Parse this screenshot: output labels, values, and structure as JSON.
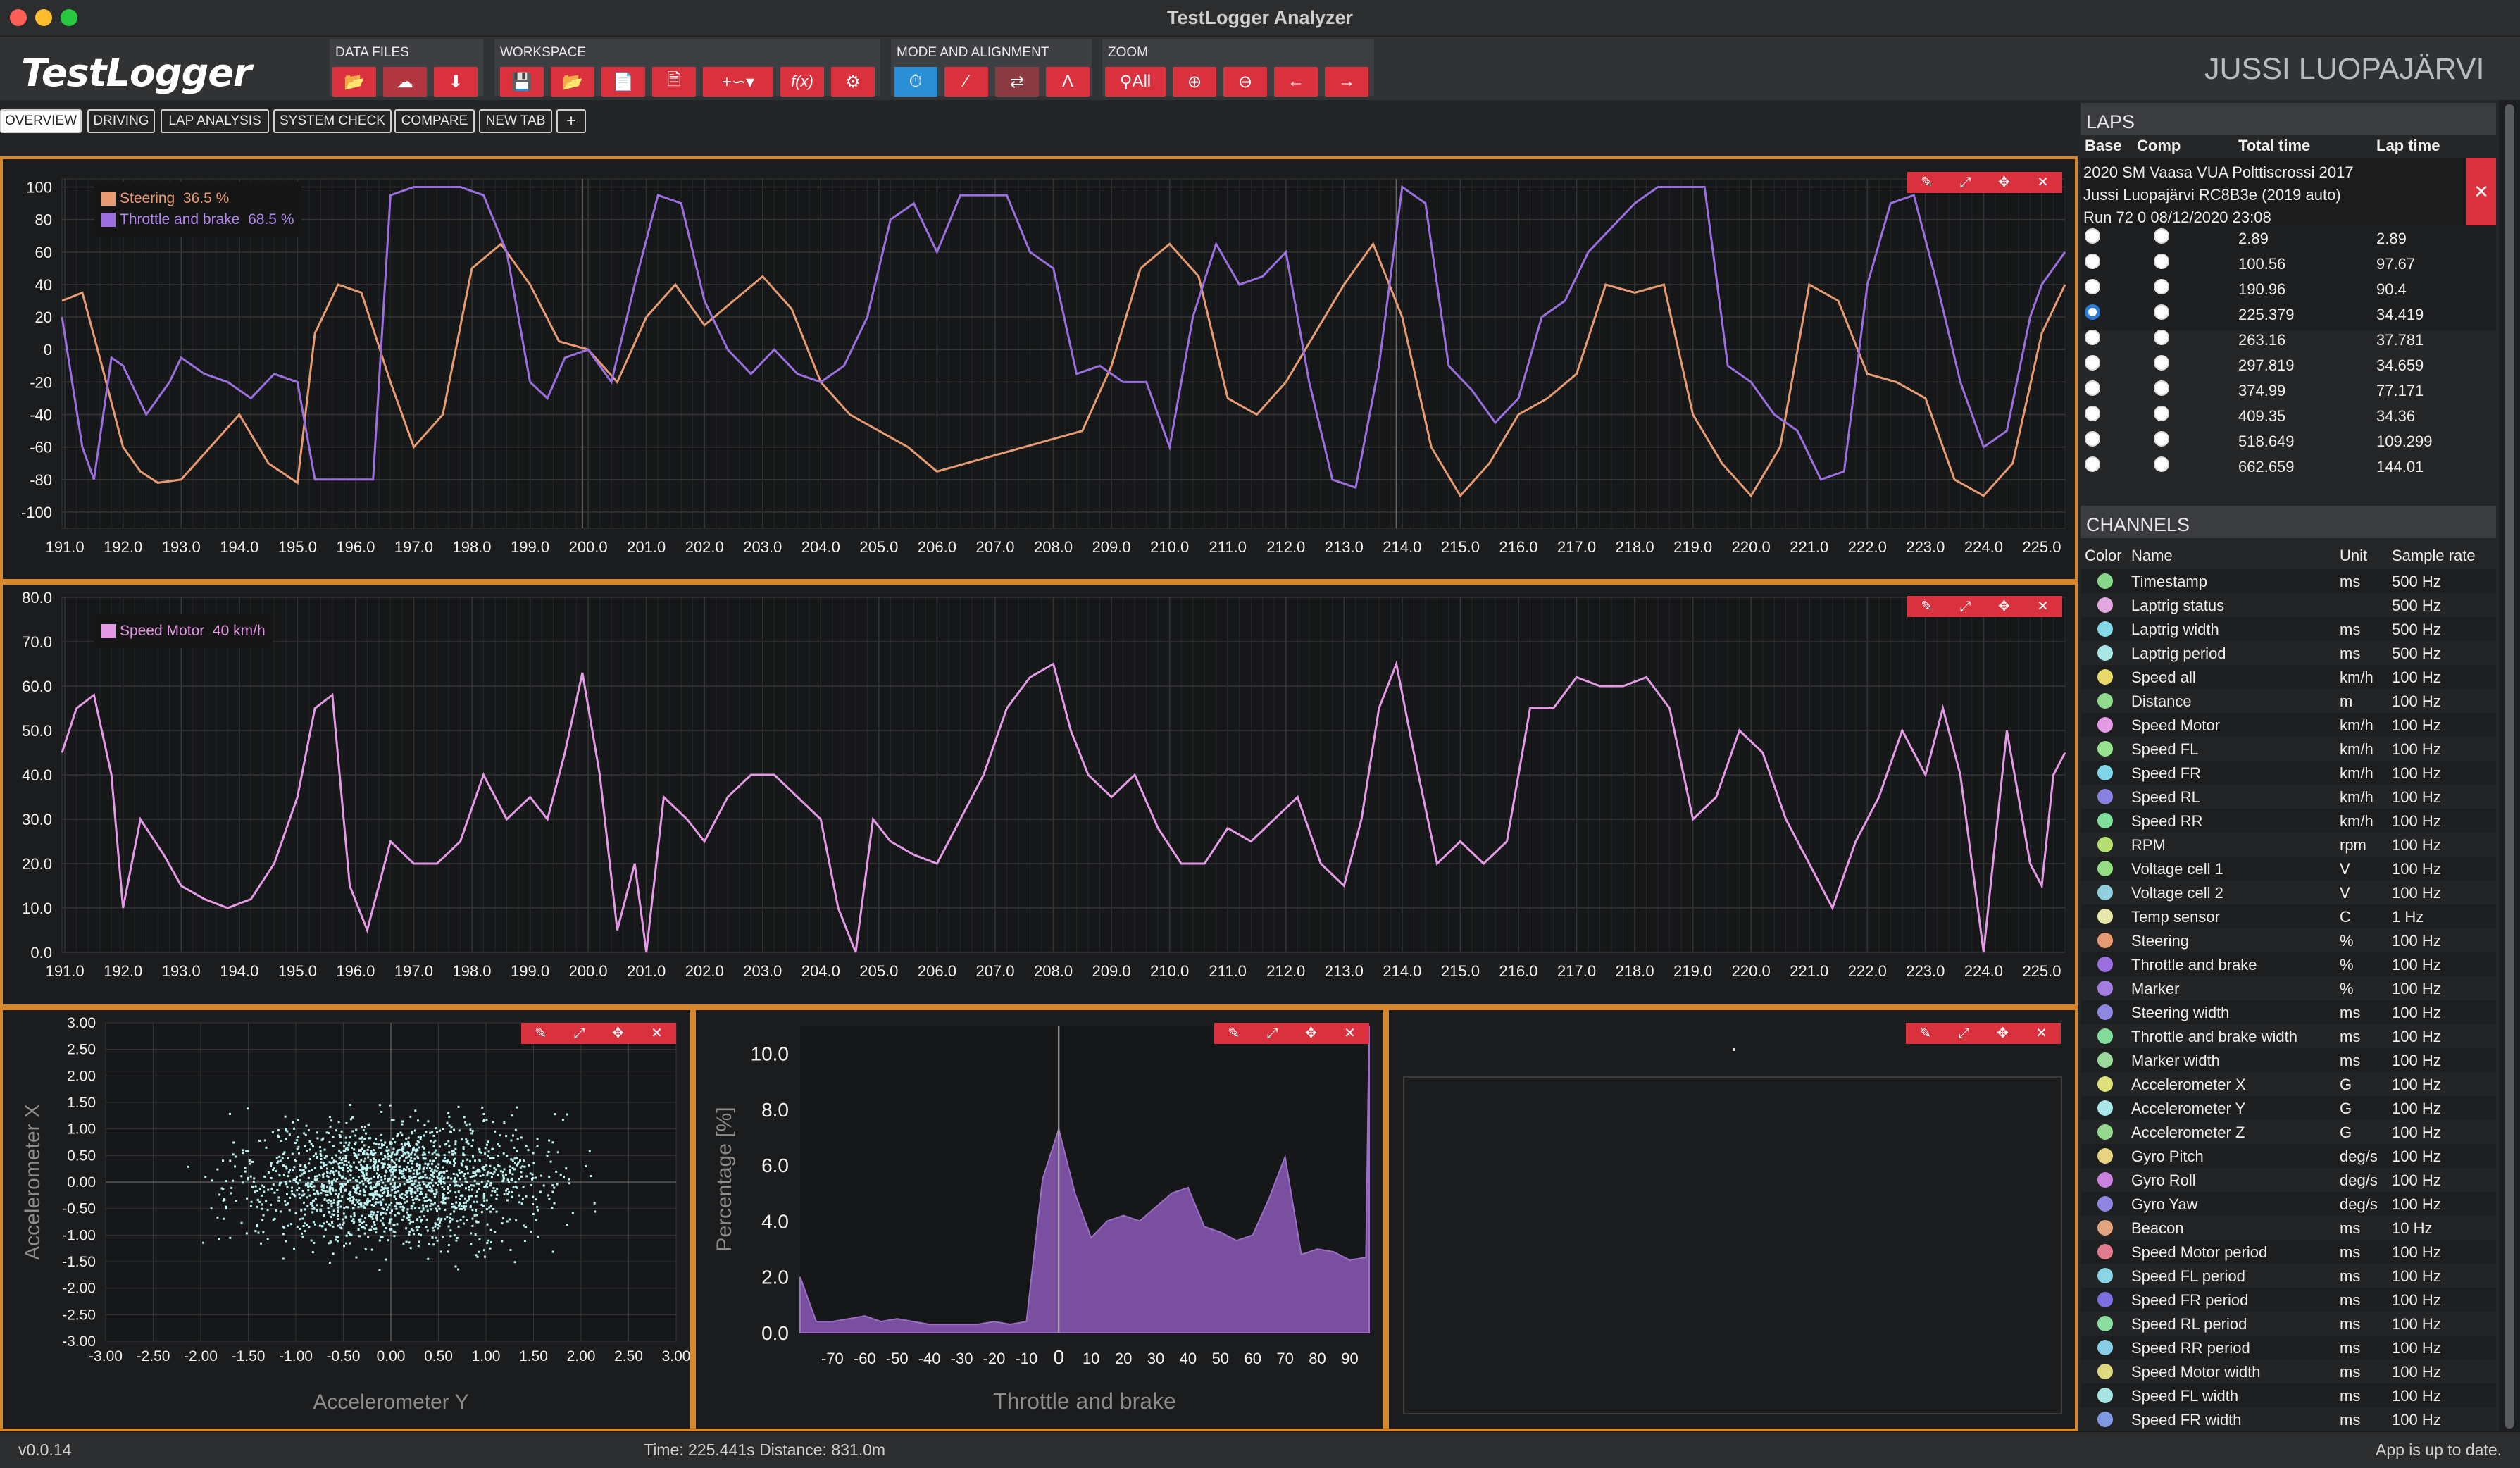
{
  "window": {
    "title": "TestLogger Analyzer"
  },
  "logo": "TestLogger",
  "toolbar": {
    "groups": [
      {
        "label": "DATA FILES"
      },
      {
        "label": "WORKSPACE"
      },
      {
        "label": "MODE AND ALIGNMENT"
      },
      {
        "label": "ZOOM"
      }
    ],
    "zoom_all": "All",
    "fx": "f(x)"
  },
  "user": "JUSSI LUOPAJÄRVI",
  "tabs": [
    "OVERVIEW",
    "DRIVING",
    "LAP ANALYSIS",
    "SYSTEM CHECK",
    "COMPARE",
    "NEW TAB",
    "+"
  ],
  "laps": {
    "title": "LAPS",
    "columns": [
      "Base",
      "Comp",
      "Total time",
      "Lap time"
    ],
    "event": "2020 SM Vaasa VUA Polttiscrossi 2017",
    "driver": "Jussi Luopajärvi RC8B3e (2019 auto)",
    "run": "Run 72 0 08/12/2020 23:08",
    "close": "✕",
    "rows": [
      {
        "total": "2.89",
        "lap": "2.89"
      },
      {
        "total": "100.56",
        "lap": "97.67"
      },
      {
        "total": "190.96",
        "lap": "90.4"
      },
      {
        "total": "225.379",
        "lap": "34.419"
      },
      {
        "total": "263.16",
        "lap": "37.781"
      },
      {
        "total": "297.819",
        "lap": "34.659"
      },
      {
        "total": "374.99",
        "lap": "77.171"
      },
      {
        "total": "409.35",
        "lap": "34.36"
      },
      {
        "total": "518.649",
        "lap": "109.299"
      },
      {
        "total": "662.659",
        "lap": "144.01"
      }
    ],
    "selected_base": 3
  },
  "channels": {
    "title": "CHANNELS",
    "columns": [
      "Color",
      "Name",
      "Unit",
      "Sample rate"
    ],
    "rows": [
      {
        "name": "Timestamp",
        "unit": "ms",
        "rate": "500 Hz",
        "color": "#88d88a"
      },
      {
        "name": "Laptrig status",
        "unit": "",
        "rate": "500 Hz",
        "color": "#e2a6e0"
      },
      {
        "name": "Laptrig width",
        "unit": "ms",
        "rate": "500 Hz",
        "color": "#84d9e8"
      },
      {
        "name": "Laptrig period",
        "unit": "ms",
        "rate": "500 Hz",
        "color": "#a9e6e6"
      },
      {
        "name": "Speed all",
        "unit": "km/h",
        "rate": "100 Hz",
        "color": "#e9d96b"
      },
      {
        "name": "Distance",
        "unit": "m",
        "rate": "100 Hz",
        "color": "#8fdc8f"
      },
      {
        "name": "Speed Motor",
        "unit": "km/h",
        "rate": "100 Hz",
        "color": "#e59ae6"
      },
      {
        "name": "Speed FL",
        "unit": "km/h",
        "rate": "100 Hz",
        "color": "#97e28f"
      },
      {
        "name": "Speed FR",
        "unit": "km/h",
        "rate": "100 Hz",
        "color": "#7fd6ea"
      },
      {
        "name": "Speed RL",
        "unit": "km/h",
        "rate": "100 Hz",
        "color": "#8a82e0"
      },
      {
        "name": "Speed RR",
        "unit": "km/h",
        "rate": "100 Hz",
        "color": "#7fdf9a"
      },
      {
        "name": "RPM",
        "unit": "rpm",
        "rate": "100 Hz",
        "color": "#b6df73"
      },
      {
        "name": "Voltage cell 1",
        "unit": "V",
        "rate": "100 Hz",
        "color": "#93dd82"
      },
      {
        "name": "Voltage cell 2",
        "unit": "V",
        "rate": "100 Hz",
        "color": "#8fcfe0"
      },
      {
        "name": "Temp sensor",
        "unit": "C",
        "rate": "1 Hz",
        "color": "#e6e6a8"
      },
      {
        "name": "Steering",
        "unit": "%",
        "rate": "100 Hz",
        "color": "#e79b72"
      },
      {
        "name": "Throttle and brake",
        "unit": "%",
        "rate": "100 Hz",
        "color": "#9b6fe0"
      },
      {
        "name": "Marker",
        "unit": "%",
        "rate": "100 Hz",
        "color": "#a37ee0"
      },
      {
        "name": "Steering width",
        "unit": "ms",
        "rate": "100 Hz",
        "color": "#8e88e2"
      },
      {
        "name": "Throttle and brake width",
        "unit": "ms",
        "rate": "100 Hz",
        "color": "#84dc9a"
      },
      {
        "name": "Marker width",
        "unit": "ms",
        "rate": "100 Hz",
        "color": "#9ad99a"
      },
      {
        "name": "Accelerometer X",
        "unit": "G",
        "rate": "100 Hz",
        "color": "#dfe27a"
      },
      {
        "name": "Accelerometer Y",
        "unit": "G",
        "rate": "100 Hz",
        "color": "#a8e8e8"
      },
      {
        "name": "Accelerometer Z",
        "unit": "G",
        "rate": "100 Hz",
        "color": "#94d98e"
      },
      {
        "name": "Gyro Pitch",
        "unit": "deg/s",
        "rate": "100 Hz",
        "color": "#e8d480"
      },
      {
        "name": "Gyro Roll",
        "unit": "deg/s",
        "rate": "100 Hz",
        "color": "#c982e0"
      },
      {
        "name": "Gyro Yaw",
        "unit": "deg/s",
        "rate": "100 Hz",
        "color": "#8f84e2"
      },
      {
        "name": "Beacon",
        "unit": "ms",
        "rate": "10 Hz",
        "color": "#e2a47e"
      },
      {
        "name": "Speed Motor period",
        "unit": "ms",
        "rate": "100 Hz",
        "color": "#e07c8e"
      },
      {
        "name": "Speed FL period",
        "unit": "ms",
        "rate": "100 Hz",
        "color": "#8ad6e6"
      },
      {
        "name": "Speed FR period",
        "unit": "ms",
        "rate": "100 Hz",
        "color": "#7e6fe0"
      },
      {
        "name": "Speed RL period",
        "unit": "ms",
        "rate": "100 Hz",
        "color": "#88dfa0"
      },
      {
        "name": "Speed RR period",
        "unit": "ms",
        "rate": "100 Hz",
        "color": "#86cfe6"
      },
      {
        "name": "Speed Motor width",
        "unit": "ms",
        "rate": "100 Hz",
        "color": "#dcd980"
      },
      {
        "name": "Speed FL width",
        "unit": "ms",
        "rate": "100 Hz",
        "color": "#a7e3e3"
      },
      {
        "name": "Speed FR width",
        "unit": "ms",
        "rate": "100 Hz",
        "color": "#7f9ae2"
      }
    ]
  },
  "status": {
    "version": "v0.0.14",
    "readout": "Time: 225.441s Distance: 831.0m",
    "update": "App is up to date."
  },
  "chart_data": [
    {
      "type": "line",
      "series": [
        {
          "name": "Steering",
          "value_label": "36.5 %",
          "color": "#e79b72"
        },
        {
          "name": "Throttle and brake",
          "value_label": "68.5 %",
          "color": "#9b6fe0"
        }
      ],
      "x_ticks": [
        "191.0",
        "192.0",
        "193.0",
        "194.0",
        "195.0",
        "196.0",
        "197.0",
        "198.0",
        "199.0",
        "200.0",
        "201.0",
        "202.0",
        "203.0",
        "204.0",
        "205.0",
        "206.0",
        "207.0",
        "208.0",
        "209.0",
        "210.0",
        "211.0",
        "212.0",
        "213.0",
        "214.0",
        "215.0",
        "216.0",
        "217.0",
        "218.0",
        "219.0",
        "220.0",
        "221.0",
        "222.0",
        "223.0",
        "224.0",
        "225.0"
      ],
      "y_ticks": [
        "100",
        "80",
        "60",
        "40",
        "20",
        "0",
        "-20",
        "-40",
        "-60",
        "-80",
        "-100"
      ],
      "xlim": [
        190.95,
        225.4
      ],
      "ylim": [
        -110,
        105
      ],
      "steering_x": [
        190.95,
        191.3,
        191.6,
        192.0,
        192.3,
        192.6,
        193.0,
        193.5,
        194.0,
        194.5,
        195.0,
        195.3,
        195.7,
        196.1,
        196.6,
        197.0,
        197.5,
        198.0,
        198.5,
        199.0,
        199.5,
        200.0,
        200.5,
        201.0,
        201.5,
        202.0,
        202.5,
        203.0,
        203.5,
        204.0,
        204.5,
        205.0,
        205.5,
        206.0,
        206.5,
        207.0,
        207.5,
        208.0,
        208.5,
        209.0,
        209.5,
        210.0,
        210.5,
        211.0,
        211.5,
        212.0,
        212.5,
        213.0,
        213.5,
        214.0,
        214.5,
        215.0,
        215.5,
        216.0,
        216.5,
        217.0,
        217.5,
        218.0,
        218.5,
        219.0,
        219.5,
        220.0,
        220.5,
        221.0,
        221.5,
        222.0,
        222.5,
        223.0,
        223.5,
        224.0,
        224.5,
        225.0,
        225.4
      ],
      "steering_y": [
        30,
        35,
        -5,
        -60,
        -75,
        -82,
        -80,
        -60,
        -40,
        -70,
        -82,
        10,
        40,
        35,
        -20,
        -60,
        -40,
        50,
        65,
        40,
        5,
        0,
        -20,
        20,
        40,
        15,
        30,
        45,
        25,
        -20,
        -40,
        -50,
        -60,
        -75,
        -70,
        -65,
        -60,
        -55,
        -50,
        -10,
        50,
        65,
        45,
        -30,
        -40,
        -20,
        10,
        40,
        65,
        20,
        -60,
        -90,
        -70,
        -40,
        -30,
        -15,
        40,
        35,
        40,
        -40,
        -70,
        -90,
        -60,
        40,
        30,
        -15,
        -20,
        -30,
        -80,
        -90,
        -70,
        10,
        40
      ],
      "throttle_x": [
        190.95,
        191.3,
        191.5,
        191.8,
        192.0,
        192.4,
        192.8,
        193.0,
        193.4,
        193.8,
        194.2,
        194.6,
        195.0,
        195.3,
        195.6,
        196.0,
        196.3,
        196.6,
        197.0,
        197.4,
        197.8,
        198.2,
        198.6,
        199.0,
        199.3,
        199.6,
        200.0,
        200.4,
        200.8,
        201.2,
        201.6,
        202.0,
        202.4,
        202.8,
        203.2,
        203.6,
        204.0,
        204.4,
        204.8,
        205.2,
        205.6,
        206.0,
        206.4,
        206.8,
        207.2,
        207.6,
        208.0,
        208.4,
        208.8,
        209.2,
        209.6,
        210.0,
        210.4,
        210.8,
        211.2,
        211.6,
        212.0,
        212.4,
        212.8,
        213.2,
        213.6,
        214.0,
        214.4,
        214.8,
        215.2,
        215.6,
        216.0,
        216.4,
        216.8,
        217.2,
        217.6,
        218.0,
        218.4,
        218.8,
        219.2,
        219.6,
        220.0,
        220.4,
        220.8,
        221.2,
        221.6,
        222.0,
        222.4,
        222.8,
        223.2,
        223.6,
        224.0,
        224.4,
        224.8,
        225.0,
        225.4
      ],
      "throttle_y": [
        20,
        -60,
        -80,
        -5,
        -10,
        -40,
        -20,
        -5,
        -15,
        -20,
        -30,
        -15,
        -20,
        -80,
        -80,
        -80,
        -80,
        95,
        100,
        100,
        100,
        95,
        60,
        -20,
        -30,
        -5,
        0,
        -20,
        40,
        95,
        90,
        30,
        0,
        -15,
        0,
        -15,
        -20,
        -10,
        20,
        80,
        90,
        60,
        95,
        95,
        95,
        60,
        50,
        -15,
        -10,
        -20,
        -20,
        -60,
        20,
        65,
        40,
        45,
        60,
        -20,
        -80,
        -85,
        -10,
        100,
        90,
        -10,
        -25,
        -45,
        -30,
        20,
        30,
        60,
        75,
        90,
        100,
        100,
        100,
        -10,
        -20,
        -40,
        -50,
        -80,
        -75,
        40,
        90,
        95,
        40,
        -20,
        -60,
        -50,
        20,
        40,
        60
      ],
      "cursor_x": [
        199.9,
        213.9
      ]
    },
    {
      "type": "line",
      "series": [
        {
          "name": "Speed Motor",
          "value_label": "40 km/h",
          "color": "#e59ae6"
        }
      ],
      "x_ticks": [
        "191.0",
        "192.0",
        "193.0",
        "194.0",
        "195.0",
        "196.0",
        "197.0",
        "198.0",
        "199.0",
        "200.0",
        "201.0",
        "202.0",
        "203.0",
        "204.0",
        "205.0",
        "206.0",
        "207.0",
        "208.0",
        "209.0",
        "210.0",
        "211.0",
        "212.0",
        "213.0",
        "214.0",
        "215.0",
        "216.0",
        "217.0",
        "218.0",
        "219.0",
        "220.0",
        "221.0",
        "222.0",
        "223.0",
        "224.0",
        "225.0"
      ],
      "y_ticks": [
        "80.0",
        "70.0",
        "60.0",
        "50.0",
        "40.0",
        "30.0",
        "20.0",
        "10.0",
        "0.0"
      ],
      "xlim": [
        190.95,
        225.4
      ],
      "ylim": [
        0,
        80
      ],
      "x": [
        190.95,
        191.2,
        191.5,
        191.8,
        192.0,
        192.3,
        192.7,
        193.0,
        193.4,
        193.8,
        194.2,
        194.6,
        195.0,
        195.3,
        195.6,
        195.9,
        196.2,
        196.6,
        197.0,
        197.4,
        197.8,
        198.2,
        198.6,
        199.0,
        199.3,
        199.6,
        199.9,
        200.2,
        200.5,
        200.8,
        201.0,
        201.3,
        201.7,
        202.0,
        202.4,
        202.8,
        203.2,
        203.6,
        204.0,
        204.3,
        204.6,
        204.9,
        205.2,
        205.6,
        206.0,
        206.4,
        206.8,
        207.2,
        207.6,
        208.0,
        208.3,
        208.6,
        209.0,
        209.4,
        209.8,
        210.2,
        210.6,
        211.0,
        211.4,
        211.8,
        212.2,
        212.6,
        213.0,
        213.3,
        213.6,
        213.9,
        214.2,
        214.6,
        215.0,
        215.4,
        215.8,
        216.2,
        216.6,
        217.0,
        217.4,
        217.8,
        218.2,
        218.6,
        219.0,
        219.4,
        219.8,
        220.2,
        220.6,
        221.0,
        221.4,
        221.8,
        222.2,
        222.6,
        223.0,
        223.3,
        223.6,
        224.0,
        224.4,
        224.8,
        225.0,
        225.2,
        225.4
      ],
      "y": [
        45,
        55,
        58,
        40,
        10,
        30,
        22,
        15,
        12,
        10,
        12,
        20,
        35,
        55,
        58,
        15,
        5,
        25,
        20,
        20,
        25,
        40,
        30,
        35,
        30,
        45,
        63,
        40,
        5,
        20,
        0,
        35,
        30,
        25,
        35,
        40,
        40,
        35,
        30,
        10,
        0,
        30,
        25,
        22,
        20,
        30,
        40,
        55,
        62,
        65,
        50,
        40,
        35,
        40,
        28,
        20,
        20,
        28,
        25,
        30,
        35,
        20,
        15,
        30,
        55,
        65,
        45,
        20,
        25,
        20,
        25,
        55,
        55,
        62,
        60,
        60,
        62,
        55,
        30,
        35,
        50,
        45,
        30,
        20,
        10,
        25,
        35,
        50,
        40,
        55,
        40,
        0,
        50,
        20,
        15,
        40,
        45
      ]
    },
    {
      "type": "scatter",
      "xlabel": "Accelerometer Y",
      "ylabel": "Accelerometer X",
      "x_ticks": [
        "-3.00",
        "-2.50",
        "-2.00",
        "-1.50",
        "-1.00",
        "-0.50",
        "0.00",
        "0.50",
        "1.00",
        "1.50",
        "2.00",
        "2.50",
        "3.00"
      ],
      "y_ticks": [
        "3.00",
        "2.50",
        "2.00",
        "1.50",
        "1.00",
        "0.50",
        "0.00",
        "-0.50",
        "-1.00",
        "-1.50",
        "-2.00",
        "-2.50",
        "-3.00"
      ],
      "xlim": [
        -3,
        3
      ],
      "ylim": [
        -3,
        3
      ],
      "spread_x": 0.75,
      "spread_y": 0.55,
      "center": [
        0,
        0
      ],
      "color": "#bff3f3"
    },
    {
      "type": "area",
      "xlabel": "Throttle and brake",
      "ylabel": "Percentage [%]",
      "x_ticks": [
        "-70",
        "-60",
        "-50",
        "-40",
        "-30",
        "-20",
        "-10",
        "0",
        "10",
        "20",
        "30",
        "40",
        "50",
        "60",
        "70",
        "80",
        "90"
      ],
      "y_ticks": [
        "10.0",
        "8.0",
        "6.0",
        "4.0",
        "2.0",
        "0.0"
      ],
      "xlim": [
        -80,
        96
      ],
      "ylim": [
        0,
        11
      ],
      "x": [
        -80,
        -75,
        -70,
        -65,
        -60,
        -55,
        -50,
        -45,
        -40,
        -35,
        -30,
        -25,
        -20,
        -15,
        -10,
        -5,
        0,
        5,
        10,
        15,
        20,
        25,
        30,
        35,
        40,
        45,
        50,
        55,
        60,
        65,
        70,
        75,
        80,
        85,
        90,
        95,
        96
      ],
      "y": [
        2.0,
        0.4,
        0.4,
        0.5,
        0.6,
        0.4,
        0.5,
        0.4,
        0.3,
        0.3,
        0.3,
        0.3,
        0.4,
        0.3,
        0.4,
        5.5,
        7.3,
        5.0,
        3.4,
        4.0,
        4.2,
        4.0,
        4.5,
        5.0,
        5.2,
        3.8,
        3.6,
        3.3,
        3.5,
        4.8,
        6.3,
        2.8,
        3.0,
        2.9,
        2.6,
        2.7,
        11.0
      ],
      "color": "#7b4fa0",
      "cursor_x": 0
    }
  ]
}
